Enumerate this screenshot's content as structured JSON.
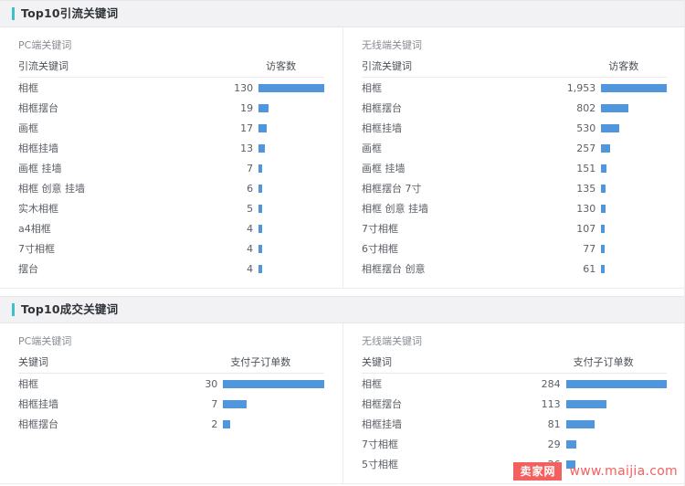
{
  "sections": [
    {
      "title": "Top10引流关键词",
      "accent_color": "#3fc0c8",
      "panels": [
        {
          "panel_title": "PC端关键词",
          "col_keyword": "引流关键词",
          "col_metric": "访客数",
          "rows": [
            {
              "keyword": "相框",
              "value": "130",
              "v": 130
            },
            {
              "keyword": "相框摆台",
              "value": "19",
              "v": 19
            },
            {
              "keyword": "画框",
              "value": "17",
              "v": 17
            },
            {
              "keyword": "相框挂墙",
              "value": "13",
              "v": 13
            },
            {
              "keyword": "画框 挂墙",
              "value": "7",
              "v": 7
            },
            {
              "keyword": "相框 创意 挂墙",
              "value": "6",
              "v": 6
            },
            {
              "keyword": "实木相框",
              "value": "5",
              "v": 5
            },
            {
              "keyword": "a4相框",
              "value": "4",
              "v": 4
            },
            {
              "keyword": "7寸相框",
              "value": "4",
              "v": 4
            },
            {
              "keyword": "摆台",
              "value": "4",
              "v": 4
            }
          ]
        },
        {
          "panel_title": "无线端关键词",
          "col_keyword": "引流关键词",
          "col_metric": "访客数",
          "rows": [
            {
              "keyword": "相框",
              "value": "1,953",
              "v": 1953
            },
            {
              "keyword": "相框摆台",
              "value": "802",
              "v": 802
            },
            {
              "keyword": "相框挂墙",
              "value": "530",
              "v": 530
            },
            {
              "keyword": "画框",
              "value": "257",
              "v": 257
            },
            {
              "keyword": "画框 挂墙",
              "value": "151",
              "v": 151
            },
            {
              "keyword": "相框摆台 7寸",
              "value": "135",
              "v": 135
            },
            {
              "keyword": "相框 创意 挂墙",
              "value": "130",
              "v": 130
            },
            {
              "keyword": "7寸相框",
              "value": "107",
              "v": 107
            },
            {
              "keyword": "6寸相框",
              "value": "77",
              "v": 77
            },
            {
              "keyword": "相框摆台 创意",
              "value": "61",
              "v": 61
            }
          ]
        }
      ]
    },
    {
      "title": "Top10成交关键词",
      "accent_color": "#3fc0c8",
      "panels": [
        {
          "panel_title": "PC端关键词",
          "col_keyword": "关键词",
          "col_metric": "支付子订单数",
          "rows": [
            {
              "keyword": "相框",
              "value": "30",
              "v": 30
            },
            {
              "keyword": "相框挂墙",
              "value": "7",
              "v": 7
            },
            {
              "keyword": "相框摆台",
              "value": "2",
              "v": 2
            }
          ]
        },
        {
          "panel_title": "无线端关键词",
          "col_keyword": "关键词",
          "col_metric": "支付子订单数",
          "rows": [
            {
              "keyword": "相框",
              "value": "284",
              "v": 284
            },
            {
              "keyword": "相框摆台",
              "value": "113",
              "v": 113
            },
            {
              "keyword": "相框挂墙",
              "value": "81",
              "v": 81
            },
            {
              "keyword": "7寸相框",
              "value": "29",
              "v": 29
            },
            {
              "keyword": "5寸相框",
              "value": "26",
              "v": 26
            }
          ]
        }
      ]
    }
  ],
  "watermark": {
    "badge": "卖家网",
    "url": "www.maijia.com",
    "color": "#f4605e"
  },
  "chart_data": [
    {
      "type": "bar",
      "title": "Top10引流关键词 — PC端关键词",
      "xlabel": "访客数",
      "ylabel": "引流关键词",
      "categories": [
        "相框",
        "相框摆台",
        "画框",
        "相框挂墙",
        "画框 挂墙",
        "相框 创意 挂墙",
        "实木相框",
        "a4相框",
        "7寸相框",
        "摆台"
      ],
      "values": [
        130,
        19,
        17,
        13,
        7,
        6,
        5,
        4,
        4,
        4
      ],
      "grid": false,
      "legend": "none"
    },
    {
      "type": "bar",
      "title": "Top10引流关键词 — 无线端关键词",
      "xlabel": "访客数",
      "ylabel": "引流关键词",
      "categories": [
        "相框",
        "相框摆台",
        "相框挂墙",
        "画框",
        "画框 挂墙",
        "相框摆台 7寸",
        "相框 创意 挂墙",
        "7寸相框",
        "6寸相框",
        "相框摆台 创意"
      ],
      "values": [
        1953,
        802,
        530,
        257,
        151,
        135,
        130,
        107,
        77,
        61
      ],
      "grid": false,
      "legend": "none"
    },
    {
      "type": "bar",
      "title": "Top10成交关键词 — PC端关键词",
      "xlabel": "支付子订单数",
      "ylabel": "关键词",
      "categories": [
        "相框",
        "相框挂墙",
        "相框摆台"
      ],
      "values": [
        30,
        7,
        2
      ],
      "grid": false,
      "legend": "none"
    },
    {
      "type": "bar",
      "title": "Top10成交关键词 — 无线端关键词",
      "xlabel": "支付子订单数",
      "ylabel": "关键词",
      "categories": [
        "相框",
        "相框摆台",
        "相框挂墙",
        "7寸相框",
        "5寸相框"
      ],
      "values": [
        284,
        113,
        81,
        29,
        26
      ],
      "grid": false,
      "legend": "none"
    }
  ]
}
